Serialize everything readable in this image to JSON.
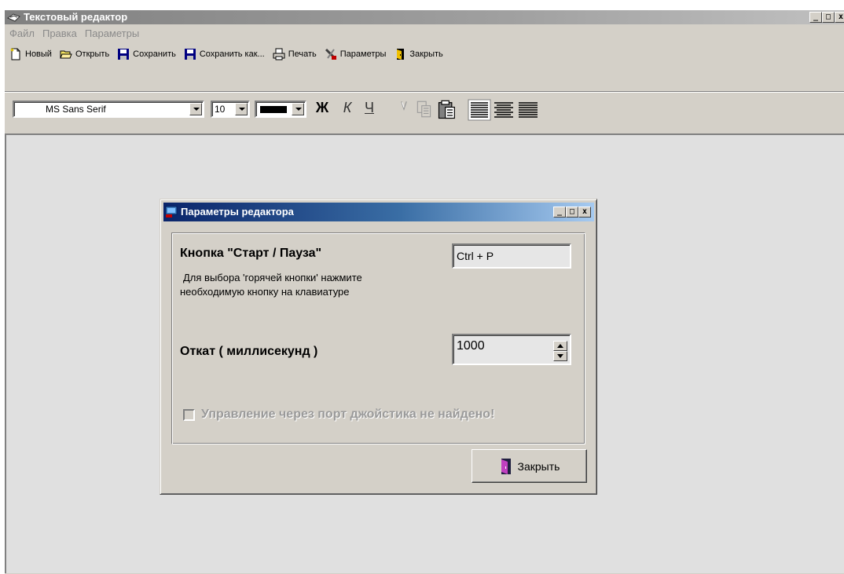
{
  "main_window": {
    "title": "Текстовый редактор",
    "controls": {
      "minimize": "_",
      "maximize": "□",
      "close": "x"
    }
  },
  "menu": [
    "Файл",
    "Правка",
    "Параметры"
  ],
  "toolbar": [
    {
      "label": "Новый",
      "icon": "new-file-icon"
    },
    {
      "label": "Открыть",
      "icon": "open-folder-icon"
    },
    {
      "label": "Сохранить",
      "icon": "floppy-icon"
    },
    {
      "label": "Сохранить как...",
      "icon": "floppy-icon"
    },
    {
      "label": "Печать",
      "icon": "printer-icon"
    },
    {
      "label": "Параметры",
      "icon": "settings-icon"
    },
    {
      "label": "Закрыть",
      "icon": "exit-door-icon"
    }
  ],
  "format_bar": {
    "font": "MS Sans Serif",
    "size": "10",
    "color": "#000000",
    "bold": "Ж",
    "italic": "К",
    "underline": "Ч"
  },
  "dialog": {
    "title": "Параметры редактора",
    "controls": {
      "minimize": "_",
      "maximize": "□",
      "close": "x"
    },
    "hotkey": {
      "title": "Кнопка \"Старт / Пауза\"",
      "hint_line1": "Для выбора 'горячей кнопки' нажмите",
      "hint_line2": "необходимую кнопку на клавиатуре",
      "value": "Ctrl + P"
    },
    "rollback": {
      "title": "Откат ( миллисекунд )",
      "value": "1000"
    },
    "joystick": {
      "label": "Управление через порт джойстика не найдено!",
      "checked": false
    },
    "close_label": "Закрыть"
  }
}
